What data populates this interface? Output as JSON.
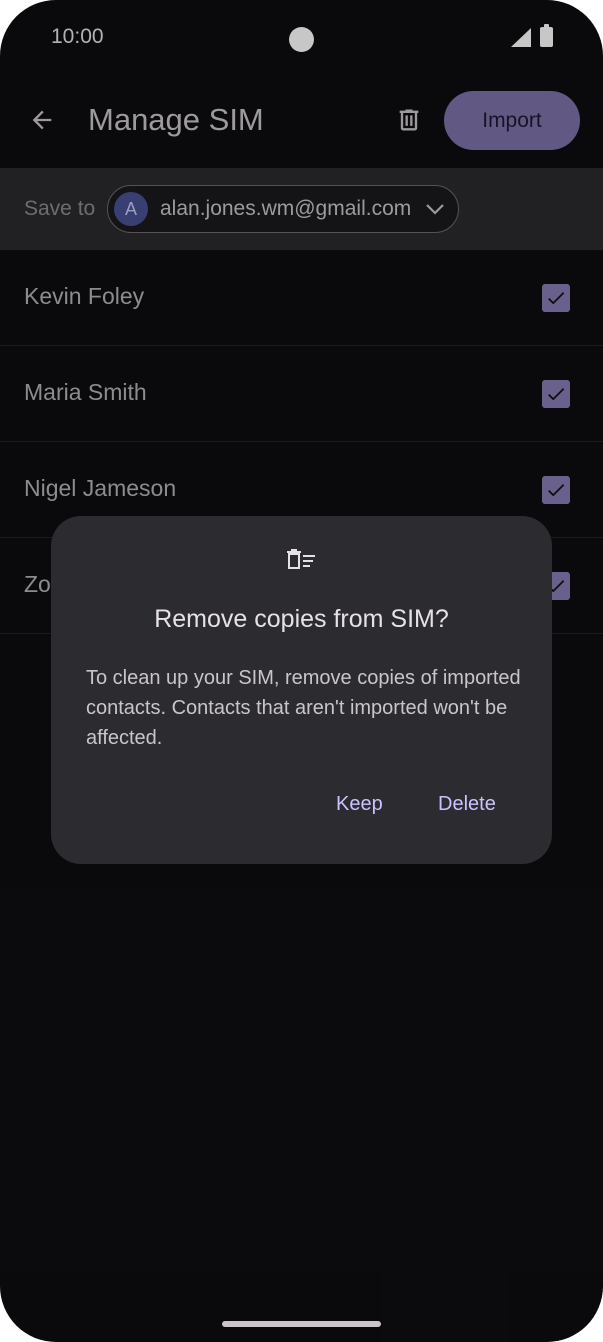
{
  "status_bar": {
    "time": "10:00"
  },
  "header": {
    "title": "Manage SIM",
    "import_label": "Import",
    "back_icon": "arrow-back-icon",
    "trash_icon": "trash-icon"
  },
  "save_to": {
    "label": "Save to",
    "avatar_letter": "A",
    "email": "alan.jones.wm@gmail.com"
  },
  "contacts": [
    {
      "name": "Kevin Foley",
      "checked": true
    },
    {
      "name": "Maria Smith",
      "checked": true
    },
    {
      "name": "Nigel Jameson",
      "checked": true
    },
    {
      "name": "Zo",
      "checked": true
    }
  ],
  "dialog": {
    "icon": "delete-sweep-icon",
    "title": "Remove copies from SIM?",
    "body": "To clean up your SIM, remove copies of imported contacts. Contacts that aren't imported won't be affected.",
    "keep_label": "Keep",
    "delete_label": "Delete"
  },
  "colors": {
    "accent": "#cdc0ff",
    "import_button": "#7d71a8",
    "checkbox": "#877cb3",
    "background": "#0e0e11"
  }
}
